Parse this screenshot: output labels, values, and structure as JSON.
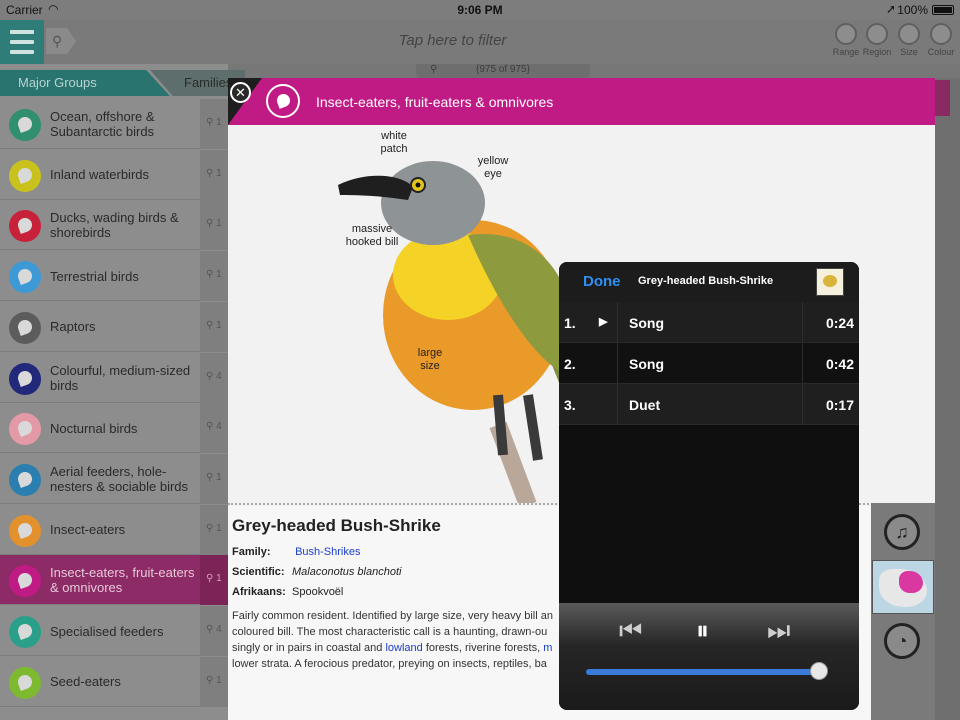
{
  "status_bar": {
    "carrier": "Carrier",
    "time": "9:06 PM",
    "battery": "100%"
  },
  "toolbar": {
    "filter_placeholder": "Tap here to filter",
    "icons": [
      {
        "label": "Range",
        "icon": "range-icon"
      },
      {
        "label": "Region",
        "icon": "region-icon"
      },
      {
        "label": "Size",
        "icon": "size-icon"
      },
      {
        "label": "Colour",
        "icon": "colour-icon"
      }
    ],
    "count": "{975 of 975}"
  },
  "sidebar": {
    "tab_major": "Major Groups",
    "tab_families": "Families",
    "groups": [
      {
        "label": "Ocean, offshore & Subantarctic birds",
        "count": "1",
        "color": "#2f8f6e"
      },
      {
        "label": "Inland waterbirds",
        "count": "1",
        "color": "#c9c21c"
      },
      {
        "label": "Ducks, wading birds & shorebirds",
        "count": "1",
        "color": "#c8223a"
      },
      {
        "label": "Terrestrial birds",
        "count": "1",
        "color": "#3e9ad6"
      },
      {
        "label": "Raptors",
        "count": "1",
        "color": "#5c5c5c"
      },
      {
        "label": "Colourful, medium-sized birds",
        "count": "4",
        "color": "#22287a"
      },
      {
        "label": "Nocturnal birds",
        "count": "4",
        "color": "#e39aa6"
      },
      {
        "label": "Aerial feeders, hole-nesters & sociable birds",
        "count": "1",
        "color": "#2a7fb0"
      },
      {
        "label": "Insect-eaters",
        "count": "1",
        "color": "#e3912c"
      },
      {
        "label": "Insect-eaters, fruit-eaters & omnivores",
        "count": "1",
        "color": "#c01a85"
      },
      {
        "label": "Specialised feeders",
        "count": "4",
        "color": "#2aa08a"
      },
      {
        "label": "Seed-eaters",
        "count": "1",
        "color": "#7dba2f"
      }
    ],
    "selected_index": 9
  },
  "panel": {
    "header_title": "Insect-eaters, fruit-eaters & omnivores",
    "callouts": {
      "white_patch": "white patch",
      "yellow_eye": "yellow eye",
      "massive_bill": "massive hooked bill",
      "large_size": "large size"
    },
    "species_name": "Grey-headed Bush-Shrike",
    "family_label": "Family:",
    "family_value": "Bush-Shrikes",
    "scientific_label": "Scientific:",
    "scientific_value": "Malaconotus blanchoti",
    "afrikaans_label": "Afrikaans:",
    "afrikaans_value": "Spookvoël",
    "description_1": "Fairly common resident. Identified by large size, very heavy bill an",
    "description_2": "coloured bill. The most characteristic call is a haunting, drawn-ou",
    "description_3a": "singly or in pairs in coastal and ",
    "description_3_link1": "lowland",
    "description_3b": " forests, riverine forests, ",
    "description_3_link2": "m",
    "description_4": "lower strata. A ferocious predator, preying on insects, reptiles, ba"
  },
  "player": {
    "done_label": "Done",
    "title": "Grey-headed Bush-Shrike",
    "tracks": [
      {
        "num": "1.",
        "name": "Song",
        "duration": "0:24",
        "playing": true
      },
      {
        "num": "2.",
        "name": "Song",
        "duration": "0:42",
        "playing": false
      },
      {
        "num": "3.",
        "name": "Duet",
        "duration": "0:17",
        "playing": false
      }
    ],
    "progress": 0.97,
    "accent_color": "#2f8ff0"
  }
}
